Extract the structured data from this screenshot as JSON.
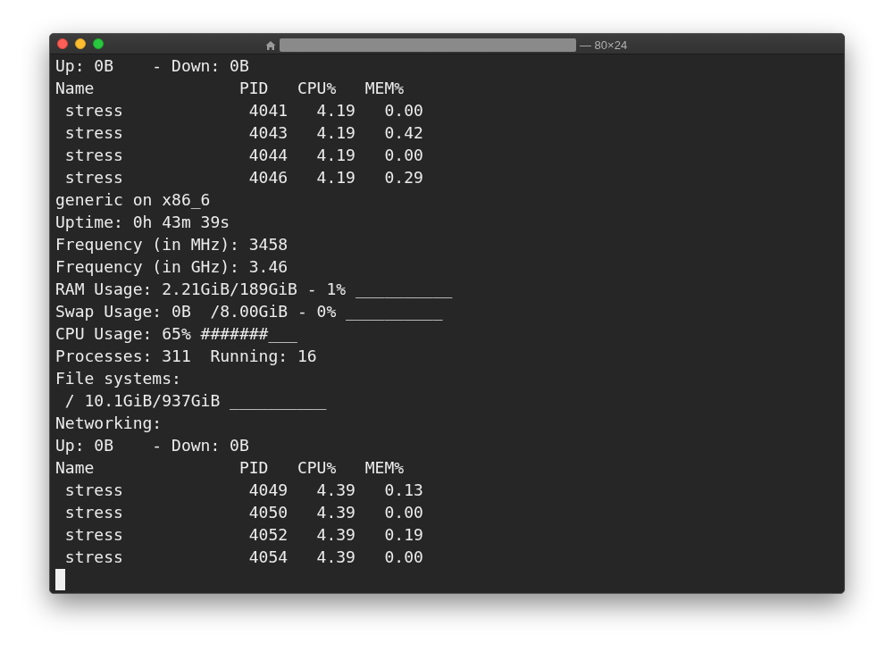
{
  "window": {
    "title": "— 80×24"
  },
  "terminal": {
    "lines": [
      "Up: 0B    - Down: 0B",
      "Name               PID   CPU%   MEM%",
      " stress             4041   4.19   0.00",
      " stress             4043   4.19   0.42",
      " stress             4044   4.19   0.00",
      " stress             4046   4.19   0.29",
      "generic on x86_6",
      "Uptime: 0h 43m 39s",
      "Frequency (in MHz): 3458",
      "Frequency (in GHz): 3.46",
      "RAM Usage: 2.21GiB/189GiB - 1% __________",
      "Swap Usage: 0B  /8.00GiB - 0% __________",
      "CPU Usage: 65% #######___",
      "Processes: 311  Running: 16",
      "File systems:",
      " / 10.1GiB/937GiB __________",
      "Networking:",
      "Up: 0B    - Down: 0B",
      "Name               PID   CPU%   MEM%",
      " stress             4049   4.39   0.13",
      " stress             4050   4.39   0.00",
      " stress             4052   4.39   0.19",
      " stress             4054   4.39   0.00"
    ],
    "cursor": true
  }
}
